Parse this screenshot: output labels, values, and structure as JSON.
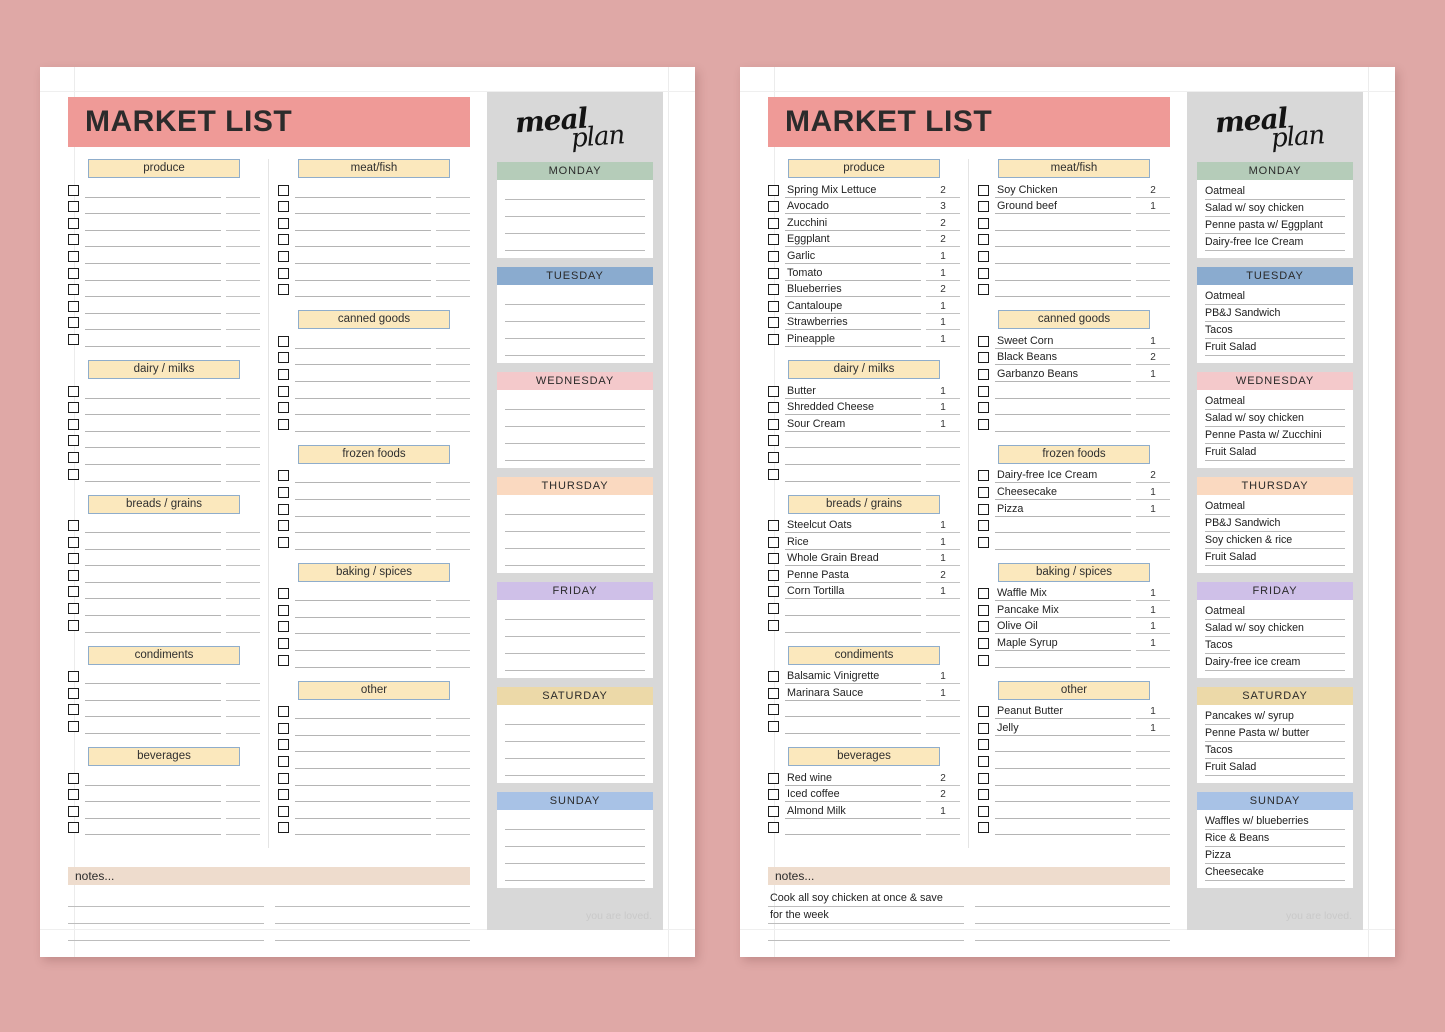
{
  "colors": {
    "background": "#dfa8a6",
    "banner": "#ef9a97",
    "category_fill": "#fbe8bd",
    "category_border": "#8fadcb",
    "notes_bar": "#eedccd",
    "sidebar": "#d8d8d8",
    "monday": "#b5ccb9",
    "tuesday": "#8aabcf",
    "wednesday": "#f4c9cb",
    "thursday": "#fad9c0",
    "friday": "#cfc0e8",
    "saturday": "#ecd9a8",
    "sunday": "#a8c2e6"
  },
  "header": {
    "title": "MARKET LIST"
  },
  "notes": {
    "label": "notes...",
    "footer": "you are loved."
  },
  "mealplan": {
    "word_meal": "meal",
    "word_plan": "plan"
  },
  "blank_page": {
    "left_column": [
      {
        "name": "produce",
        "rows": 10,
        "items": []
      },
      {
        "name": "dairy / milks",
        "rows": 6,
        "items": []
      },
      {
        "name": "breads / grains",
        "rows": 7,
        "items": []
      },
      {
        "name": "condiments",
        "rows": 4,
        "items": []
      },
      {
        "name": "beverages",
        "rows": 4,
        "items": []
      }
    ],
    "right_column": [
      {
        "name": "meat/fish",
        "rows": 7,
        "items": []
      },
      {
        "name": "canned goods",
        "rows": 6,
        "items": []
      },
      {
        "name": "frozen foods",
        "rows": 5,
        "items": []
      },
      {
        "name": "baking / spices",
        "rows": 5,
        "items": []
      },
      {
        "name": "other",
        "rows": 8,
        "items": []
      }
    ],
    "notes_lines": [
      "",
      "",
      ""
    ],
    "notes_lines_right": [
      "",
      "",
      ""
    ],
    "days": [
      {
        "name": "MONDAY",
        "color": "#b5ccb9",
        "meals": [
          "",
          "",
          "",
          ""
        ]
      },
      {
        "name": "TUESDAY",
        "color": "#8aabcf",
        "meals": [
          "",
          "",
          "",
          ""
        ]
      },
      {
        "name": "WEDNESDAY",
        "color": "#f4c9cb",
        "meals": [
          "",
          "",
          "",
          ""
        ]
      },
      {
        "name": "THURSDAY",
        "color": "#fad9c0",
        "meals": [
          "",
          "",
          "",
          ""
        ]
      },
      {
        "name": "FRIDAY",
        "color": "#cfc0e8",
        "meals": [
          "",
          "",
          "",
          ""
        ]
      },
      {
        "name": "SATURDAY",
        "color": "#ecd9a8",
        "meals": [
          "",
          "",
          "",
          ""
        ]
      },
      {
        "name": "SUNDAY",
        "color": "#a8c2e6",
        "meals": [
          "",
          "",
          "",
          ""
        ]
      }
    ]
  },
  "filled_page": {
    "left_column": [
      {
        "name": "produce",
        "rows": 10,
        "items": [
          {
            "label": "Spring Mix Lettuce",
            "qty": "2"
          },
          {
            "label": "Avocado",
            "qty": "3"
          },
          {
            "label": "Zucchini",
            "qty": "2"
          },
          {
            "label": "Eggplant",
            "qty": "2"
          },
          {
            "label": "Garlic",
            "qty": "1"
          },
          {
            "label": "Tomato",
            "qty": "1"
          },
          {
            "label": "Blueberries",
            "qty": "2"
          },
          {
            "label": "Cantaloupe",
            "qty": "1"
          },
          {
            "label": "Strawberries",
            "qty": "1"
          },
          {
            "label": "Pineapple",
            "qty": "1"
          }
        ]
      },
      {
        "name": "dairy / milks",
        "rows": 6,
        "items": [
          {
            "label": "Butter",
            "qty": "1"
          },
          {
            "label": "Shredded Cheese",
            "qty": "1"
          },
          {
            "label": "Sour Cream",
            "qty": "1"
          }
        ]
      },
      {
        "name": "breads / grains",
        "rows": 7,
        "items": [
          {
            "label": "Steelcut Oats",
            "qty": "1"
          },
          {
            "label": "Rice",
            "qty": "1"
          },
          {
            "label": "Whole Grain Bread",
            "qty": "1"
          },
          {
            "label": "Penne Pasta",
            "qty": "2"
          },
          {
            "label": "Corn Tortilla",
            "qty": "1"
          }
        ]
      },
      {
        "name": "condiments",
        "rows": 4,
        "items": [
          {
            "label": "Balsamic Vinigrette",
            "qty": "1"
          },
          {
            "label": "Marinara Sauce",
            "qty": "1"
          }
        ]
      },
      {
        "name": "beverages",
        "rows": 4,
        "items": [
          {
            "label": "Red wine",
            "qty": "2"
          },
          {
            "label": "Iced coffee",
            "qty": "2"
          },
          {
            "label": "Almond Milk",
            "qty": "1"
          }
        ]
      }
    ],
    "right_column": [
      {
        "name": "meat/fish",
        "rows": 7,
        "items": [
          {
            "label": "Soy Chicken",
            "qty": "2"
          },
          {
            "label": "Ground beef",
            "qty": "1"
          }
        ]
      },
      {
        "name": "canned goods",
        "rows": 6,
        "items": [
          {
            "label": "Sweet Corn",
            "qty": "1"
          },
          {
            "label": "Black Beans",
            "qty": "2"
          },
          {
            "label": "Garbanzo Beans",
            "qty": "1"
          }
        ]
      },
      {
        "name": "frozen foods",
        "rows": 5,
        "items": [
          {
            "label": "Dairy-free Ice Cream",
            "qty": "2"
          },
          {
            "label": "Cheesecake",
            "qty": "1"
          },
          {
            "label": "Pizza",
            "qty": "1"
          }
        ]
      },
      {
        "name": "baking / spices",
        "rows": 5,
        "items": [
          {
            "label": "Waffle Mix",
            "qty": "1"
          },
          {
            "label": "Pancake Mix",
            "qty": "1"
          },
          {
            "label": "Olive Oil",
            "qty": "1"
          },
          {
            "label": "Maple Syrup",
            "qty": "1"
          }
        ]
      },
      {
        "name": "other",
        "rows": 8,
        "items": [
          {
            "label": "Peanut Butter",
            "qty": "1"
          },
          {
            "label": "Jelly",
            "qty": "1"
          }
        ]
      }
    ],
    "notes_lines": [
      "Cook all soy chicken at once & save",
      "for the week",
      ""
    ],
    "notes_lines_right": [
      "",
      "",
      ""
    ],
    "days": [
      {
        "name": "MONDAY",
        "color": "#b5ccb9",
        "meals": [
          "Oatmeal",
          "Salad w/ soy chicken",
          "Penne pasta w/ Eggplant",
          "Dairy-free Ice Cream"
        ]
      },
      {
        "name": "TUESDAY",
        "color": "#8aabcf",
        "meals": [
          "Oatmeal",
          "PB&J Sandwich",
          "Tacos",
          "Fruit Salad"
        ]
      },
      {
        "name": "WEDNESDAY",
        "color": "#f4c9cb",
        "meals": [
          "Oatmeal",
          "Salad w/ soy chicken",
          "Penne Pasta w/ Zucchini",
          "Fruit Salad"
        ]
      },
      {
        "name": "THURSDAY",
        "color": "#fad9c0",
        "meals": [
          "Oatmeal",
          "PB&J Sandwich",
          "Soy chicken & rice",
          "Fruit Salad"
        ]
      },
      {
        "name": "FRIDAY",
        "color": "#cfc0e8",
        "meals": [
          "Oatmeal",
          "Salad w/ soy chicken",
          "Tacos",
          "Dairy-free ice cream"
        ]
      },
      {
        "name": "SATURDAY",
        "color": "#ecd9a8",
        "meals": [
          "Pancakes w/ syrup",
          "Penne Pasta w/ butter",
          "Tacos",
          "Fruit Salad"
        ]
      },
      {
        "name": "SUNDAY",
        "color": "#a8c2e6",
        "meals": [
          "Waffles w/ blueberries",
          "Rice & Beans",
          "Pizza",
          "Cheesecake"
        ]
      }
    ]
  }
}
